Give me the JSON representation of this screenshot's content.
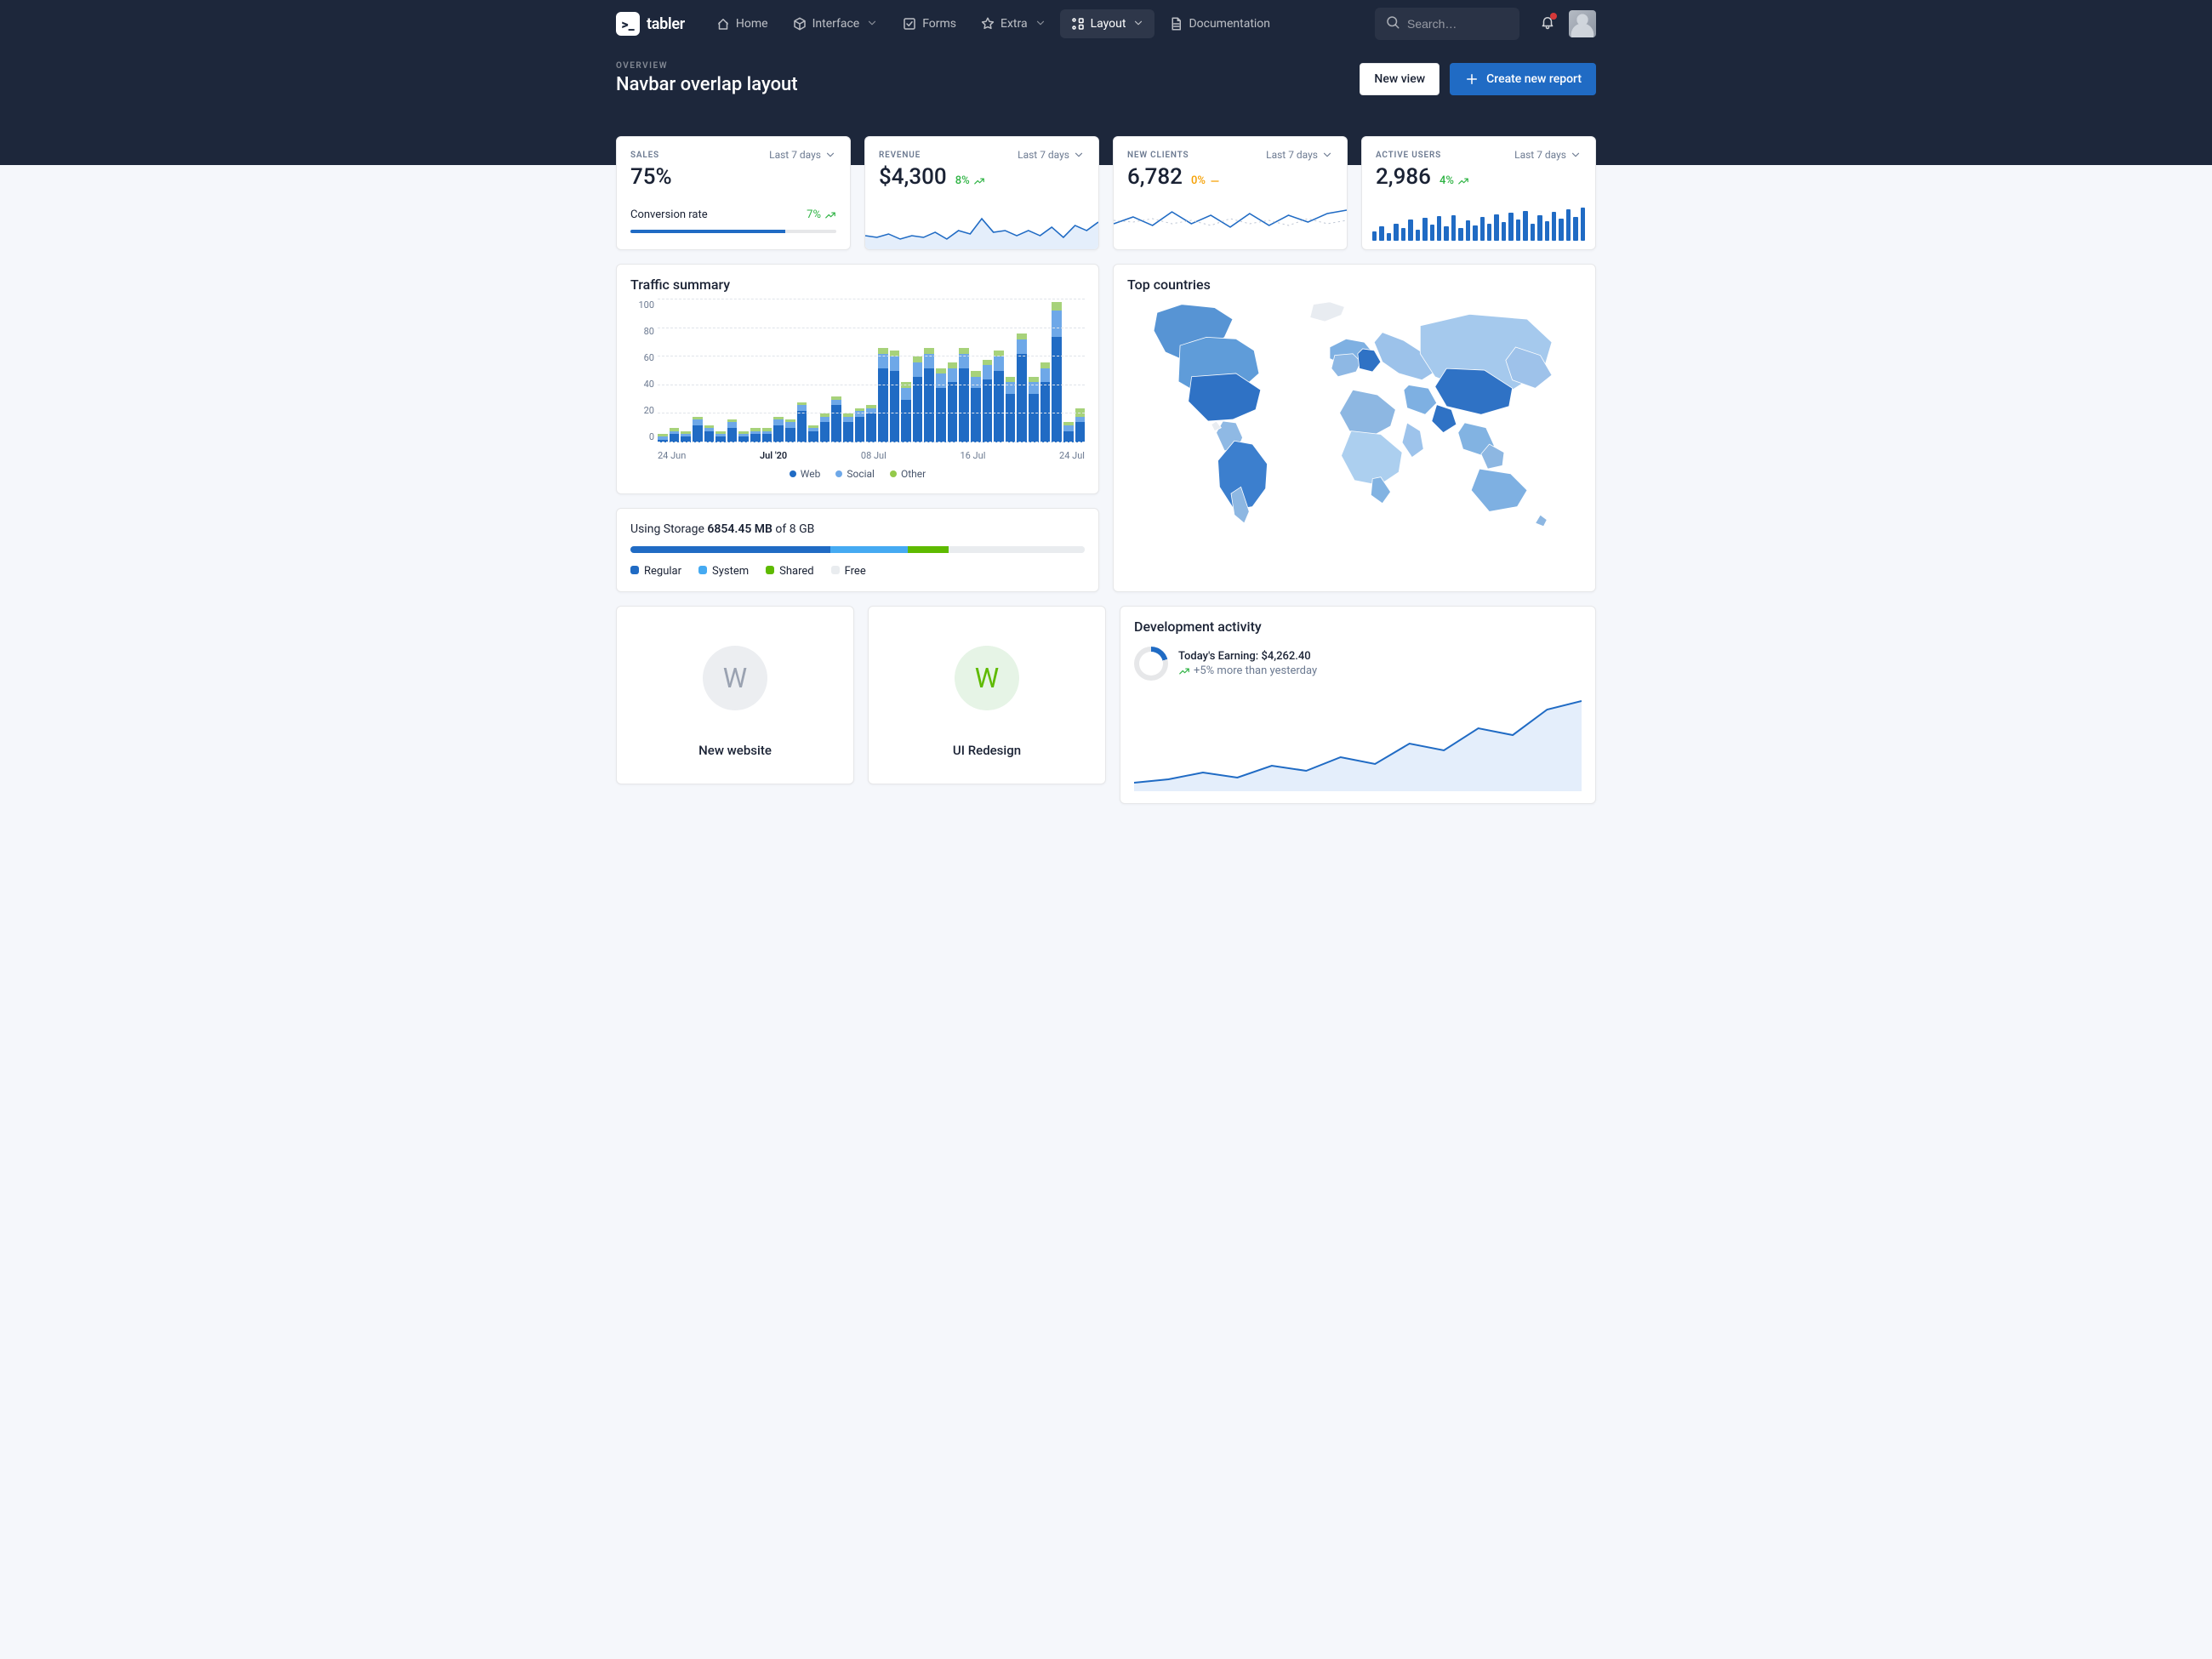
{
  "brand": "tabler",
  "nav": {
    "items": [
      {
        "label": "Home",
        "caret": false,
        "active": false
      },
      {
        "label": "Interface",
        "caret": true,
        "active": false
      },
      {
        "label": "Forms",
        "caret": false,
        "active": false
      },
      {
        "label": "Extra",
        "caret": true,
        "active": false
      },
      {
        "label": "Layout",
        "caret": true,
        "active": true
      },
      {
        "label": "Documentation",
        "caret": false,
        "active": false
      }
    ],
    "search_placeholder": "Search…"
  },
  "header": {
    "pretitle": "OVERVIEW",
    "title": "Navbar overlap layout",
    "new_view": "New view",
    "create_report": "Create new report"
  },
  "stats": {
    "period_label": "Last 7 days",
    "sales": {
      "label": "SALES",
      "value": "75%",
      "conv_label": "Conversion rate",
      "conv_pct": "7%",
      "conv_bar": 75
    },
    "revenue": {
      "label": "REVENUE",
      "value": "$4,300",
      "delta": "8%",
      "delta_class": "delta-green"
    },
    "clients": {
      "label": "NEW CLIENTS",
      "value": "6,782",
      "delta": "0%",
      "delta_class": "delta-yellow"
    },
    "active": {
      "label": "ACTIVE USERS",
      "value": "2,986",
      "delta": "4%",
      "delta_class": "delta-green",
      "bars": [
        22,
        34,
        18,
        40,
        30,
        50,
        26,
        54,
        38,
        58,
        34,
        60,
        30,
        48,
        36,
        56,
        40,
        62,
        44,
        66,
        50,
        70,
        40,
        60,
        46,
        68,
        52,
        74,
        56,
        78
      ]
    }
  },
  "traffic": {
    "title": "Traffic summary",
    "legend": {
      "web": "Web",
      "social": "Social",
      "other": "Other"
    }
  },
  "chart_data": {
    "type": "bar",
    "title": "Traffic summary",
    "ylim": [
      0,
      100
    ],
    "y_ticks": [
      0,
      20,
      40,
      60,
      80,
      100
    ],
    "x_ticks": [
      "24 Jun",
      "Jul '20",
      "08 Jul",
      "16 Jul",
      "24 Jul"
    ],
    "series": [
      {
        "name": "Web",
        "color": "#206bc4",
        "values": [
          2,
          6,
          4,
          12,
          8,
          4,
          10,
          4,
          6,
          6,
          12,
          10,
          22,
          8,
          14,
          26,
          14,
          18,
          20,
          52,
          50,
          30,
          46,
          52,
          38,
          42,
          52,
          38,
          44,
          50,
          34,
          62,
          34,
          42,
          74,
          8,
          14
        ]
      },
      {
        "name": "Social",
        "color": "#6ea8e8",
        "values": [
          2,
          2,
          2,
          4,
          2,
          2,
          4,
          2,
          2,
          2,
          4,
          4,
          4,
          2,
          4,
          4,
          4,
          4,
          4,
          10,
          10,
          8,
          10,
          10,
          10,
          10,
          10,
          8,
          10,
          10,
          8,
          10,
          8,
          10,
          18,
          4,
          4
        ]
      },
      {
        "name": "Other",
        "color": "#a7d27a",
        "values": [
          2,
          2,
          2,
          2,
          2,
          2,
          2,
          2,
          2,
          2,
          2,
          2,
          2,
          2,
          2,
          2,
          2,
          2,
          2,
          4,
          4,
          4,
          4,
          4,
          4,
          4,
          4,
          4,
          4,
          4,
          4,
          4,
          4,
          4,
          6,
          2,
          6
        ]
      }
    ]
  },
  "countries": {
    "title": "Top countries"
  },
  "storage": {
    "prefix": "Using Storage ",
    "used": "6854.45 MB",
    "suffix": " of 8 GB",
    "segments": [
      {
        "label": "Regular",
        "color": "#206bc4",
        "pct": 44
      },
      {
        "label": "System",
        "color": "#45aaf2",
        "pct": 17
      },
      {
        "label": "Shared",
        "color": "#5eba00",
        "pct": 9
      },
      {
        "label": "Free",
        "color": "#e9ecef",
        "pct": 30
      }
    ]
  },
  "projects": [
    {
      "initial": "W",
      "title": "New website",
      "color": "grey"
    },
    {
      "initial": "W",
      "title": "UI Redesign",
      "color": "green"
    }
  ],
  "dev": {
    "title": "Development activity",
    "earning_label": "Today's Earning: ",
    "earning_value": "$4,262.40",
    "more": "+5% more than yesterday"
  }
}
